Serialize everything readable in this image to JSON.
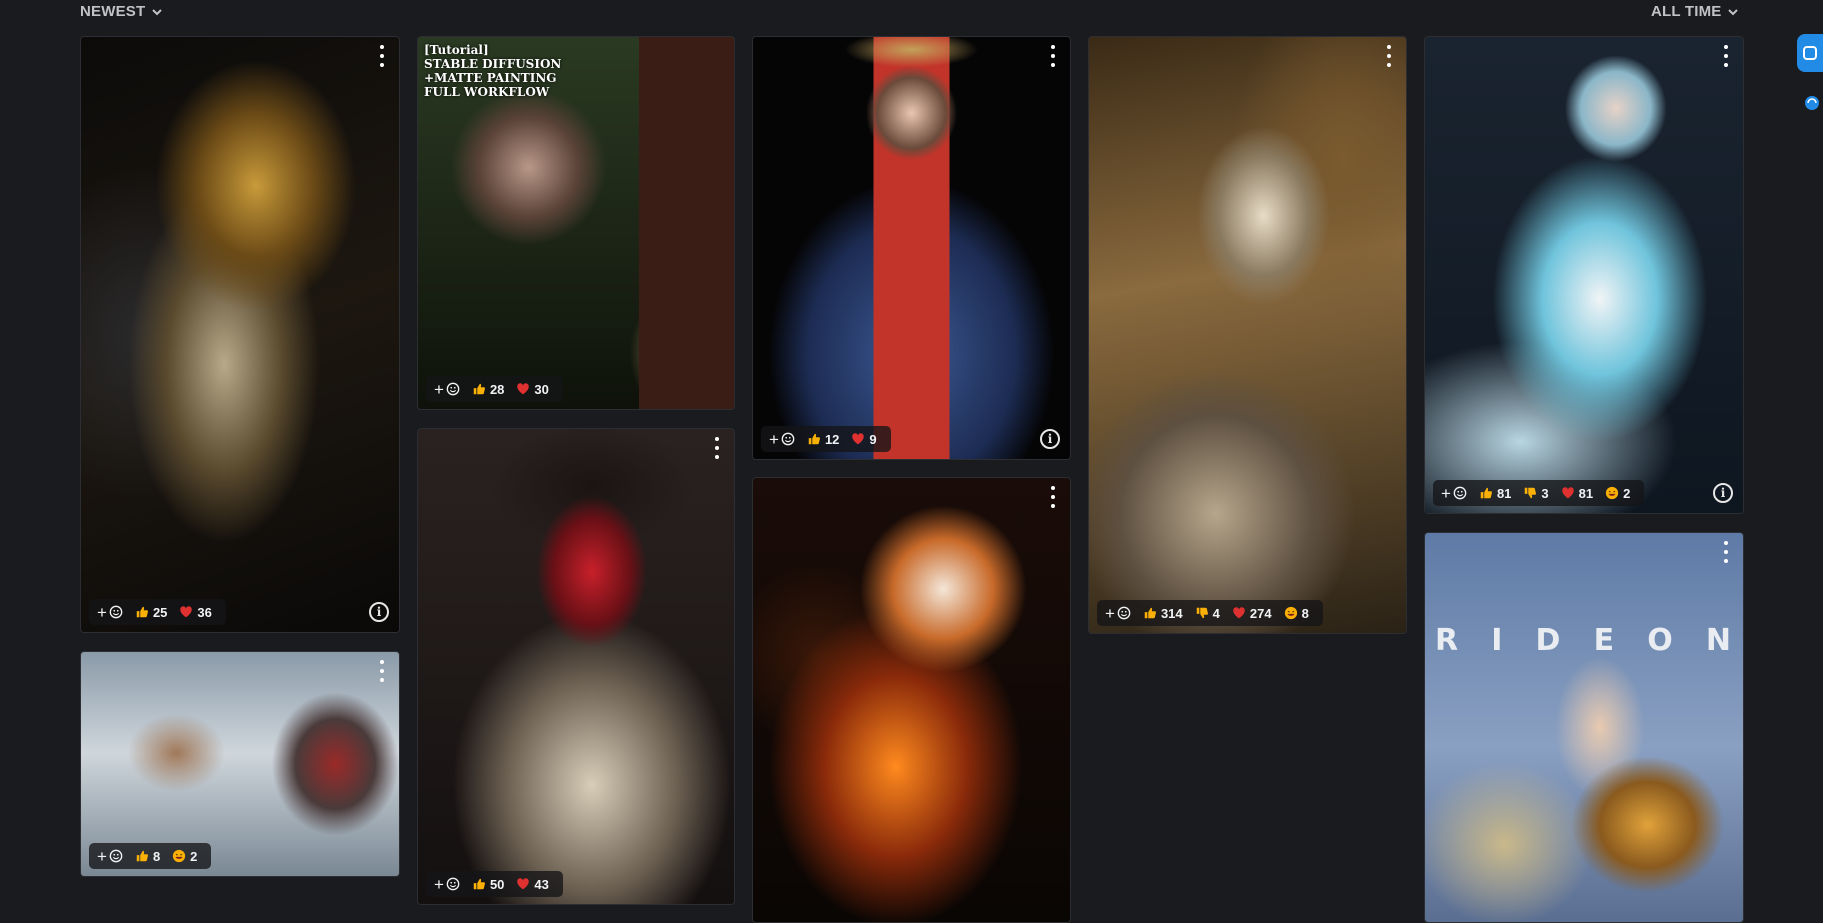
{
  "toolbar": {
    "sort_label": "NEWEST",
    "period_label": "ALL TIME"
  },
  "cards": [
    {
      "id": "c1",
      "reactions": [
        {
          "type": "like",
          "count": "25"
        },
        {
          "type": "heart",
          "count": "36"
        }
      ]
    },
    {
      "id": "c2",
      "title": "[Tutorial]\nSTABLE DIFFUSION\n+MATTE PAINTING\nFULL WORKFLOW",
      "reactions": [
        {
          "type": "like",
          "count": "28"
        },
        {
          "type": "heart",
          "count": "30"
        }
      ]
    },
    {
      "id": "c3",
      "reactions": [
        {
          "type": "like",
          "count": "12"
        },
        {
          "type": "heart",
          "count": "9"
        }
      ]
    },
    {
      "id": "c4",
      "reactions": [
        {
          "type": "like",
          "count": "314"
        },
        {
          "type": "dislike",
          "count": "4"
        },
        {
          "type": "heart",
          "count": "274"
        },
        {
          "type": "laugh",
          "count": "8"
        }
      ]
    },
    {
      "id": "c5",
      "reactions": [
        {
          "type": "like",
          "count": "81"
        },
        {
          "type": "dislike",
          "count": "3"
        },
        {
          "type": "heart",
          "count": "81"
        },
        {
          "type": "laugh",
          "count": "2"
        }
      ]
    },
    {
      "id": "c6",
      "reactions": [
        {
          "type": "like",
          "count": "8"
        },
        {
          "type": "laugh",
          "count": "2"
        }
      ]
    },
    {
      "id": "c7",
      "reactions": [
        {
          "type": "like",
          "count": "50"
        },
        {
          "type": "heart",
          "count": "43"
        }
      ]
    },
    {
      "id": "c8",
      "reactions": []
    },
    {
      "id": "c9",
      "overlay_text": [
        "R",
        "I",
        "D",
        "E",
        "O",
        "N"
      ],
      "reactions": []
    }
  ],
  "colors": {
    "background": "#1a1b1e",
    "accent": "#228be6",
    "heart": "#e03131",
    "like": "#fab005"
  }
}
